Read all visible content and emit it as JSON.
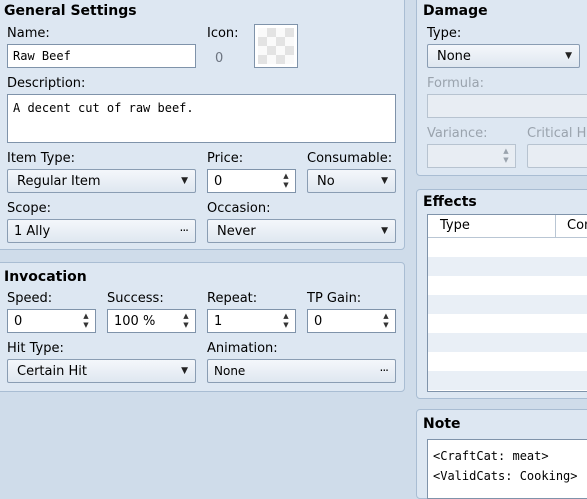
{
  "general": {
    "title": "General Settings",
    "name_label": "Name:",
    "name_value": "Raw Beef",
    "icon_label": "Icon:",
    "icon_index": "0",
    "description_label": "Description:",
    "description_value": "A decent cut of raw beef.",
    "item_type_label": "Item Type:",
    "item_type_value": "Regular Item",
    "price_label": "Price:",
    "price_value": "0",
    "consumable_label": "Consumable:",
    "consumable_value": "No",
    "scope_label": "Scope:",
    "scope_value": "1 Ally",
    "occasion_label": "Occasion:",
    "occasion_value": "Never"
  },
  "invocation": {
    "title": "Invocation",
    "speed_label": "Speed:",
    "speed_value": "0",
    "success_label": "Success:",
    "success_value": "100 %",
    "repeat_label": "Repeat:",
    "repeat_value": "1",
    "tp_gain_label": "TP Gain:",
    "tp_gain_value": "0",
    "hit_type_label": "Hit Type:",
    "hit_type_value": "Certain Hit",
    "animation_label": "Animation:",
    "animation_value": "None"
  },
  "damage": {
    "title": "Damage",
    "type_label": "Type:",
    "type_value": "None",
    "formula_label": "Formula:",
    "variance_label": "Variance:",
    "critical_label": "Critical H"
  },
  "effects": {
    "title": "Effects",
    "columns": [
      "Type",
      "Con"
    ]
  },
  "note": {
    "title": "Note",
    "lines": [
      "<CraftCat: meat>",
      "<ValidCats: Cooking>"
    ]
  },
  "icons": {
    "dropdown": "triangle-down",
    "spin": "up-down-arrows",
    "ellipsis": "ellipsis"
  }
}
